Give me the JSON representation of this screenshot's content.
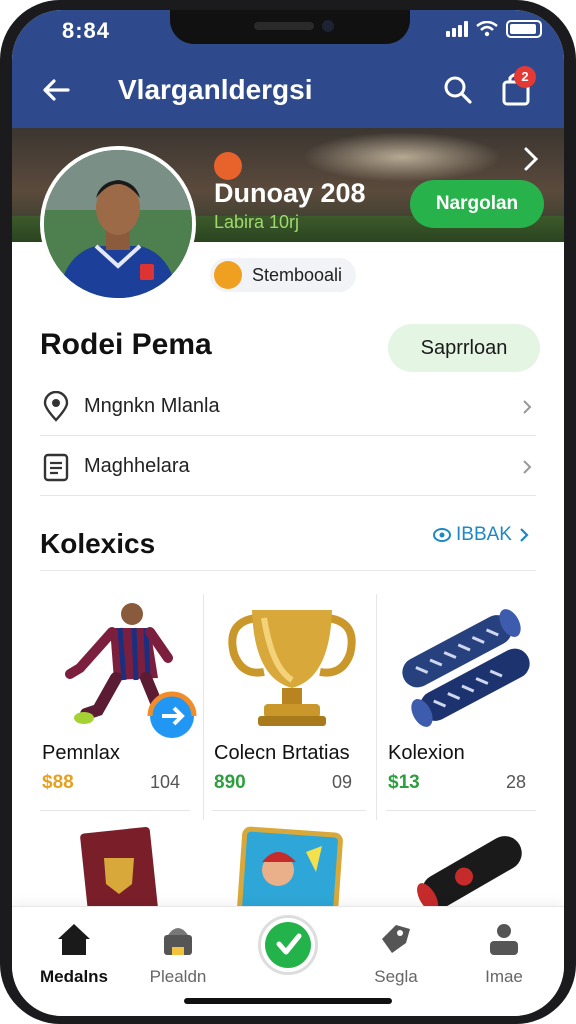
{
  "status": {
    "time": "8:84"
  },
  "header": {
    "title": "Vlarganldergsi",
    "cart_badge": "2"
  },
  "banner": {
    "title": "Dunoay 208",
    "subtitle": "Labira 10rj",
    "follow_label": "Nargolan",
    "team_label": "Stembooali"
  },
  "profile": {
    "name": "Rodei Pema",
    "save_label": "Saprrloan",
    "rows": [
      {
        "icon": "location-pin-icon",
        "label": "Mngnkn Mlanla"
      },
      {
        "icon": "document-icon",
        "label": "Maghhelara"
      }
    ]
  },
  "collections": {
    "title": "Kolexics",
    "see_all": "IBBAK",
    "items": [
      {
        "name": "Pemnlax",
        "price": "$88",
        "count": "104",
        "price_color": "#e8a020"
      },
      {
        "name": "Colecn Brtatias",
        "price": "890",
        "count": "09",
        "price_color": "#2e9f3e"
      },
      {
        "name": "Kolexion",
        "price": "$13",
        "count": "28",
        "price_color": "#2e9f3e"
      }
    ]
  },
  "nav": {
    "items": [
      {
        "label": "Medalns",
        "icon": "home-icon",
        "active": true
      },
      {
        "label": "Plealdn",
        "icon": "shop-icon",
        "active": false
      },
      {
        "label": "",
        "icon": "play-icon",
        "active": false
      },
      {
        "label": "Segla",
        "icon": "tag-icon",
        "active": false
      },
      {
        "label": "Imae",
        "icon": "profile-icon",
        "active": false
      }
    ]
  },
  "colors": {
    "primary": "#2e4a8c",
    "accent_green": "#28b24b",
    "link_blue": "#1e88c7"
  }
}
